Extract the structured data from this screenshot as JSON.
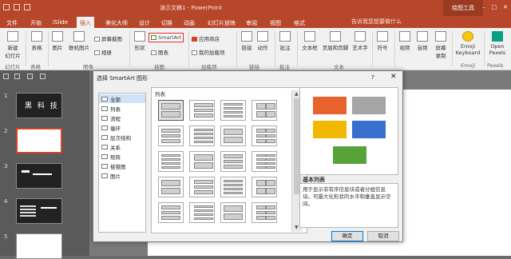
{
  "titlebar": {
    "doc_title": "演示文稿1 - PowerPoint",
    "context_tools": "绘图工具"
  },
  "tabs": [
    "文件",
    "开始",
    "iSlide",
    "插入",
    "美化大师",
    "设计",
    "切换",
    "动画",
    "幻灯片放映",
    "审阅",
    "视图",
    "格式"
  ],
  "search_placeholder": "告诉我您想要做什么",
  "ribbon": {
    "buttons": {
      "new_slide": "新建\n幻灯片",
      "table": "表格",
      "picture": "图片",
      "online_picture": "联机图片",
      "screenshot": "屏幕截图",
      "album": "相册",
      "shapes": "形状",
      "smartart": "SmartArt",
      "chart": "图表",
      "store": "应用商店",
      "my_addins": "我的加载项",
      "link": "链接",
      "action": "动作",
      "comment": "批注",
      "textbox": "文本框",
      "header_footer": "页眉和页脚",
      "wordart": "艺术字",
      "symbols": "符号",
      "video": "视频",
      "audio": "音频",
      "screen_record": "屏幕\n录制",
      "emoji_keyboard": "Emoji\nKeyboard",
      "open_pexels": "Open\nPexels"
    },
    "groups": {
      "slides": "幻灯片",
      "tables": "表格",
      "images": "图像",
      "illustrations": "插图",
      "addins": "加载项",
      "links": "链接",
      "comments": "批注",
      "text": "文本",
      "emoji": "Emoji",
      "pexels": "Pexels"
    }
  },
  "slides": {
    "numbers": [
      "1",
      "2",
      "3",
      "4",
      "5"
    ],
    "slide1_text": "黑 科 技"
  },
  "dialog": {
    "title": "选择 SmartArt 图形",
    "help": "?",
    "close": "✕",
    "categories": [
      "全部",
      "列表",
      "流程",
      "循环",
      "层次结构",
      "关系",
      "矩阵",
      "棱锥图",
      "图片"
    ],
    "gallery_title": "列表",
    "preview_title": "基本列表",
    "description": "用于显示非有序信息块或者分组信息块。可最大化形状的水平和垂直显示空间。",
    "ok": "确定",
    "cancel": "取消"
  },
  "colors": {
    "accent": "#b7472a",
    "preview_boxes": [
      "#e8622b",
      "#a5a5a5",
      "#f2b700",
      "#3a6fcf",
      "#58a23a"
    ]
  }
}
